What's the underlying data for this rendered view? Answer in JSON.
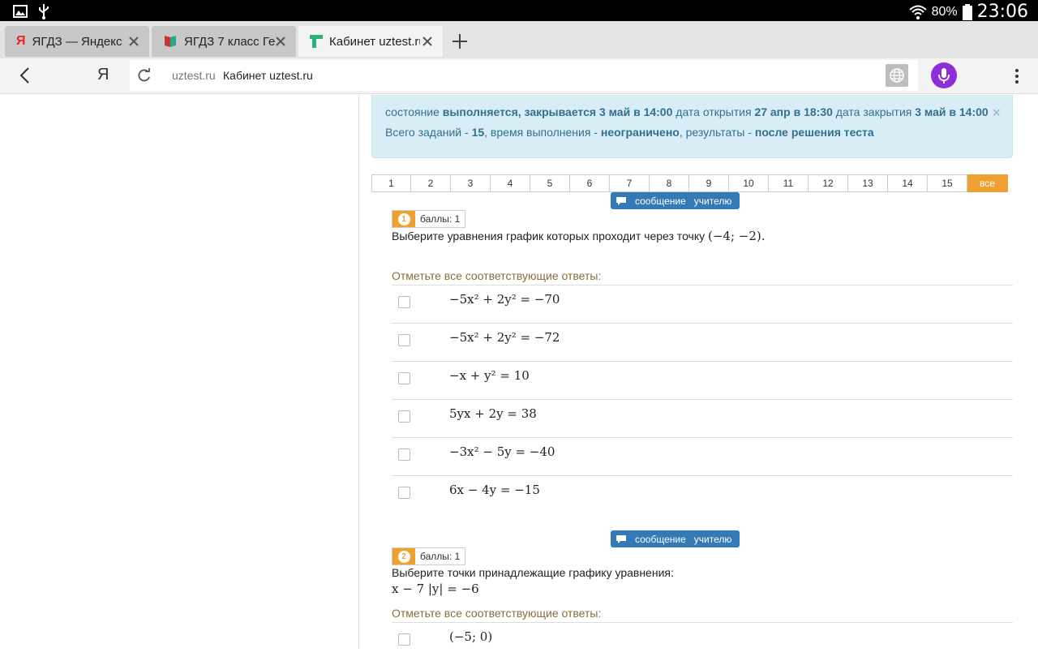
{
  "status_bar": {
    "battery_pct": "80%",
    "time": "23:06"
  },
  "tabs": [
    {
      "title": "ЯГДЗ — Яндекс:",
      "active": false
    },
    {
      "title": "ЯГДЗ 7 класс Ге",
      "active": false
    },
    {
      "title": "Кабинет uztest.ru",
      "active": true
    }
  ],
  "address": {
    "ya": "Я",
    "domain": "uztest.ru",
    "page": "Кабинет uztest.ru"
  },
  "alert": {
    "s_label": "состояние",
    "s_value": "выполняется, закрывается 3 май в 14:00",
    "open_label": "дата открытия",
    "open_value": "27 апр в 18:30",
    "close_label": "дата закрытия",
    "close_value": "3 май в 14:00",
    "total_label": "Всего заданий -",
    "total_value": "15",
    "time_label": ", время выполнения -",
    "time_value": "неограничено",
    "results_label": ", результаты -",
    "results_value": "после решения теста",
    "close_x": "×"
  },
  "pager": [
    "1",
    "2",
    "3",
    "4",
    "5",
    "6",
    "7",
    "8",
    "9",
    "10",
    "11",
    "12",
    "13",
    "14",
    "15",
    "все"
  ],
  "message_button": "сообщение   учителю",
  "q1": {
    "num": "1",
    "score": "баллы: 1",
    "text": "Выберите уравнения график которых проходит через точку ",
    "point": "(−4; −2).",
    "hint": "Отметьте все соответствующие ответы:",
    "answers": [
      "−5x² + 2y² = −70",
      "−5x² + 2y² = −72",
      "−x + y² = 10",
      "5yx + 2y = 38",
      "−3x² − 5y = −40",
      "6x − 4y = −15"
    ]
  },
  "q2": {
    "num": "2",
    "score": "баллы: 1",
    "text": "Выберите точки принадлежащие графику уравнения:",
    "equation": "x − 7 |y| = −6",
    "hint": "Отметьте все соответствующие ответы:",
    "answers": [
      "(−5; 0)"
    ]
  }
}
